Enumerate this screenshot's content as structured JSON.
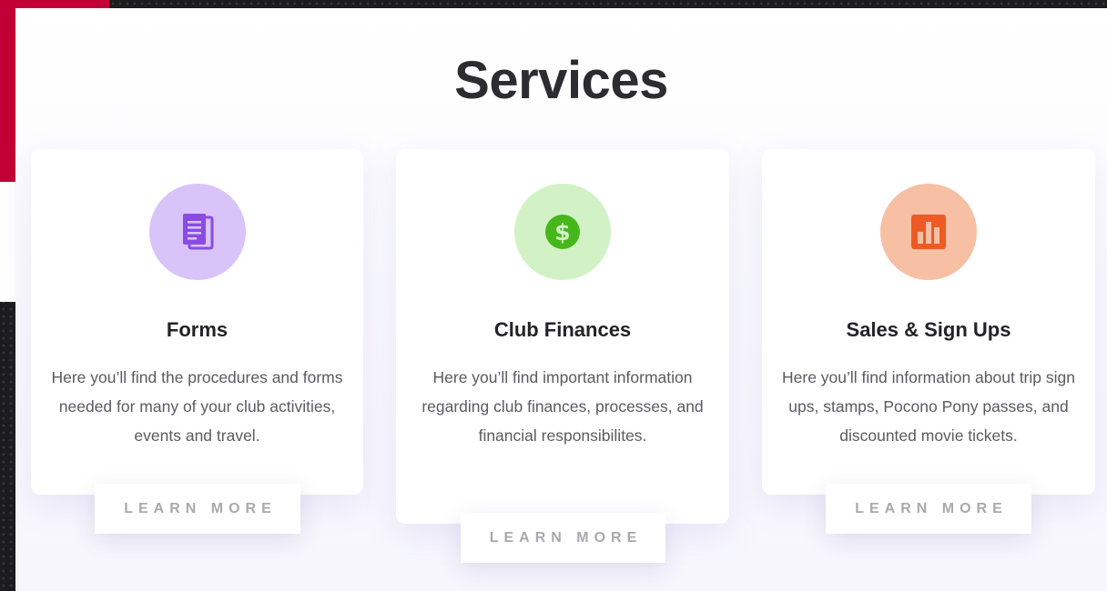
{
  "page": {
    "title": "Services",
    "colors": {
      "accent_red": "#c20036",
      "forms_circle": "#d8c4f9",
      "forms_icon": "#8a4be3",
      "finances_circle": "#d2f2c6",
      "finances_icon": "#46b71b",
      "sales_circle": "#f7c0a5",
      "sales_icon": "#ee5a24"
    }
  },
  "cards": [
    {
      "icon": "document-icon",
      "title": "Forms",
      "description": "Here you’ll find the procedures and forms needed for many of your club activities, events and travel.",
      "button": "LEARN MORE"
    },
    {
      "icon": "dollar-icon",
      "title": "Club Finances",
      "description": "Here you’ll find important information regarding club finances, processes, and financial responsibilites.",
      "button": "LEARN MORE"
    },
    {
      "icon": "bar-chart-icon",
      "title": "Sales & Sign Ups",
      "description": "Here you’ll find information about trip sign ups, stamps, Pocono Pony passes, and discounted movie tickets.",
      "button": "LEARN MORE"
    }
  ]
}
